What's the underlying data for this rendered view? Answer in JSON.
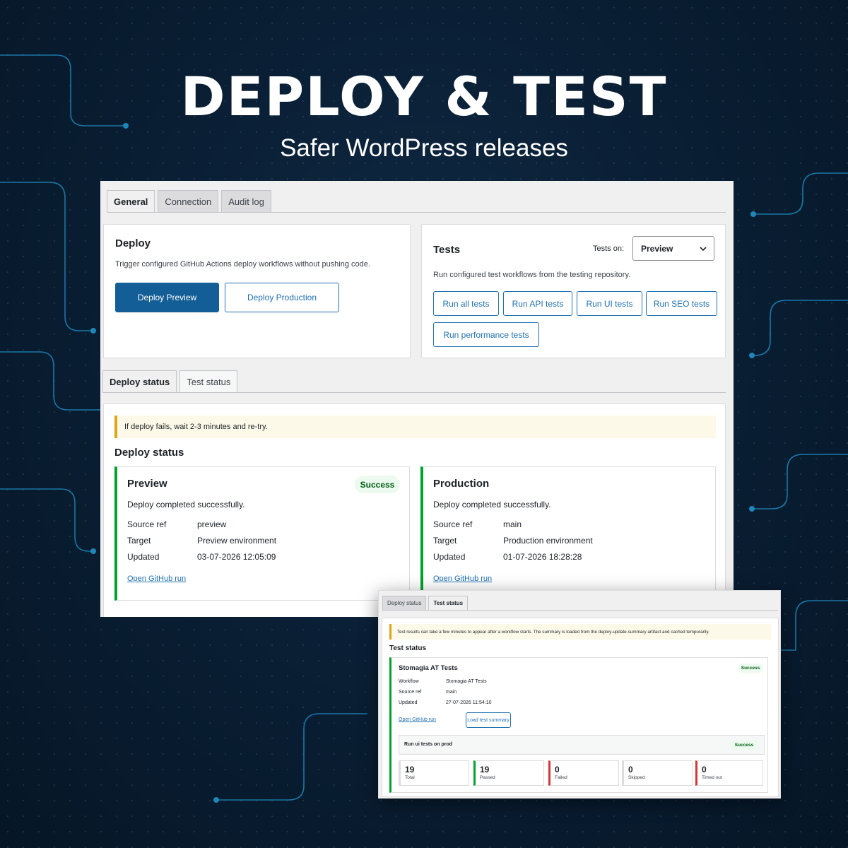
{
  "hero": {
    "title": "DEPLOY & TEST",
    "subtitle": "Safer WordPress releases"
  },
  "colors": {
    "accent": "#2271b1",
    "primary_button": "#135e96",
    "success": "#00a32a",
    "failure": "#d63638",
    "notice": "#dba617",
    "background": "#0a1f35"
  },
  "main_tabs": [
    "General",
    "Connection",
    "Audit log"
  ],
  "deploy": {
    "title": "Deploy",
    "description": "Trigger configured GitHub Actions deploy workflows without pushing code.",
    "preview_button": "Deploy Preview",
    "production_button": "Deploy Production"
  },
  "tests": {
    "title": "Tests",
    "tests_on_label": "Tests on:",
    "tests_on_value": "Preview",
    "description": "Run configured test workflows from the testing repository.",
    "buttons": [
      "Run all tests",
      "Run API tests",
      "Run UI tests",
      "Run SEO tests",
      "Run performance tests"
    ]
  },
  "status_tabs": [
    "Deploy status",
    "Test status"
  ],
  "deploy_status": {
    "notice": "If deploy fails, wait 2-3 minutes and re-try.",
    "heading": "Deploy status",
    "preview": {
      "title": "Preview",
      "badge": "Success",
      "message": "Deploy completed successfully.",
      "source_ref_label": "Source ref",
      "source_ref": "preview",
      "target_label": "Target",
      "target": "Preview environment",
      "updated_label": "Updated",
      "updated": "03-07-2026 12:05:09",
      "link": "Open GitHub run"
    },
    "production": {
      "title": "Production",
      "message": "Deploy completed successfully.",
      "source_ref_label": "Source ref",
      "source_ref": "main",
      "target_label": "Target",
      "target": "Production environment",
      "updated_label": "Updated",
      "updated": "01-07-2026 18:28:28",
      "link": "Open GitHub run"
    }
  },
  "overlay": {
    "tabs": [
      "Deploy status",
      "Test status"
    ],
    "notice": "Test results can take a few minutes to appear after a workflow starts. The summary is loaded from the deploy-update-summary artifact and cached temporarily.",
    "heading": "Test status",
    "card": {
      "title": "Stomagia AT Tests",
      "badge": "Success",
      "workflow_label": "Workflow",
      "workflow": "Stomagia AT Tests",
      "source_ref_label": "Source ref",
      "source_ref": "main",
      "updated_label": "Updated",
      "updated": "27-07-2026 11:54:10",
      "link": "Open GitHub run",
      "load_button": "Load test summary",
      "run_title": "Run ui tests on prod",
      "run_badge": "Success",
      "stats": [
        {
          "value": "19",
          "label": "Total"
        },
        {
          "value": "19",
          "label": "Passed"
        },
        {
          "value": "0",
          "label": "Failed"
        },
        {
          "value": "0",
          "label": "Skipped"
        },
        {
          "value": "0",
          "label": "Timed out"
        }
      ]
    }
  }
}
